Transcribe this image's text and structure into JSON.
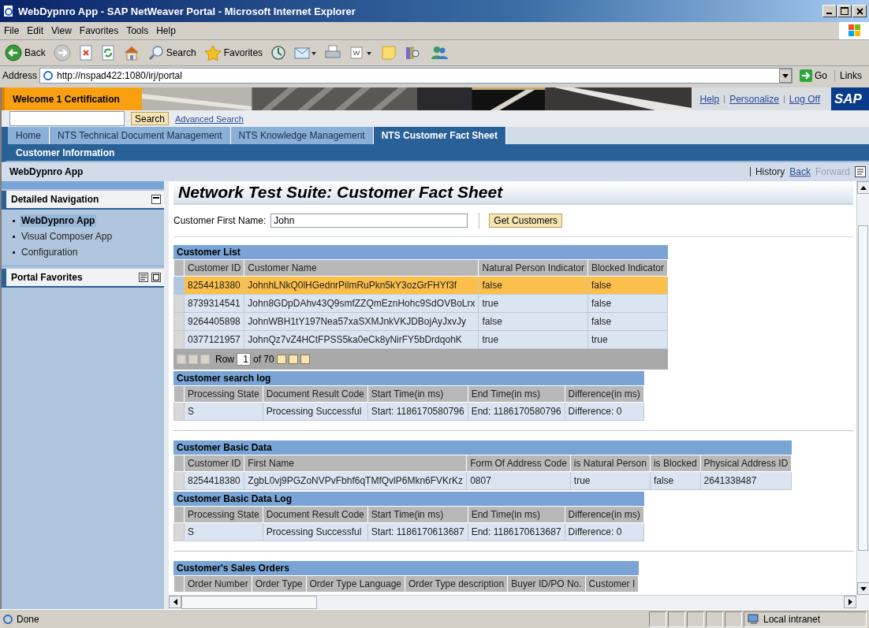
{
  "window": {
    "title": "WebDypnro App - SAP NetWeaver Portal - Microsoft Internet Explorer"
  },
  "menu": [
    "File",
    "Edit",
    "View",
    "Favorites",
    "Tools",
    "Help"
  ],
  "toolbar": [
    {
      "kind": "back",
      "label": "Back"
    },
    {
      "kind": "forward"
    },
    {
      "kind": "stop"
    },
    {
      "kind": "refresh"
    },
    {
      "kind": "home"
    },
    {
      "kind": "search",
      "label": "Search"
    },
    {
      "kind": "favorites",
      "label": "Favorites"
    },
    {
      "kind": "media"
    },
    {
      "kind": "mail"
    },
    {
      "kind": "print"
    },
    {
      "kind": "edit"
    },
    {
      "kind": "folder"
    },
    {
      "kind": "research"
    },
    {
      "kind": "messenger"
    }
  ],
  "address": {
    "label": "Address",
    "value": "http://nspad422:1080/irj/portal",
    "go": "Go",
    "links": "Links"
  },
  "portal": {
    "welcome": "Welcome 1 Certification",
    "links": [
      "Help",
      "Personalize",
      "Log Off"
    ],
    "logo": "SAP",
    "search_button": "Search",
    "advanced_search": "Advanced Search"
  },
  "tabs": [
    {
      "label": "Home",
      "selected": false
    },
    {
      "label": "NTS Technical Document Management",
      "selected": false
    },
    {
      "label": "NTS Knowledge Management",
      "selected": false
    },
    {
      "label": "NTS Customer Fact Sheet",
      "selected": true
    }
  ],
  "subnav": [
    "Customer Information"
  ],
  "page": {
    "title": "WebDypnro App",
    "history": "History",
    "back": {
      "label": "Back",
      "disabled": false
    },
    "forward": {
      "label": "Forward",
      "disabled": true
    }
  },
  "sidebar": {
    "panels": [
      {
        "title": "Detailed Navigation",
        "items": [
          {
            "label": "WebDypnro App",
            "selected": true
          },
          {
            "label": "Visual Composer App",
            "selected": false
          },
          {
            "label": "Configuration",
            "selected": false
          }
        ]
      },
      {
        "title": "Portal Favorites"
      }
    ]
  },
  "content": {
    "heading": "Network Test Suite: Customer Fact Sheet",
    "form": {
      "label": "Customer First Name:",
      "value": "John",
      "button": "Get Customers"
    },
    "sections": [
      {
        "title": "Customer List",
        "columns": [
          "Customer ID",
          "Customer Name",
          "Natural Person Indicator",
          "Blocked Indicator"
        ],
        "rows": [
          {
            "cells": [
              "8254418380",
              "JohnhLNkQ0lHGednrPilmRuPkn5kY3ozGrFHYf3f",
              "false",
              "false"
            ],
            "selected": true
          },
          {
            "cells": [
              "8739314541",
              "John8GDpDAhv43Q9smfZZQmEznHohc9SdOVBoLrx",
              "true",
              "false"
            ],
            "selected": false
          },
          {
            "cells": [
              "9264405898",
              "JohnWBH1tY197Nea57xaSXMJnkVKJDBojAyJxvJy",
              "false",
              "false"
            ],
            "selected": false
          },
          {
            "cells": [
              "0377121957",
              "JohnQz7vZ4HCtFPSS5ka0eCk8yNirFY5bDrdqohK",
              "true",
              "true"
            ],
            "selected": false
          }
        ],
        "pager": {
          "label": "Row",
          "value": "1",
          "of": "of 70"
        }
      },
      {
        "title": "Customer search log",
        "columns": [
          "Processing State",
          "Document Result Code",
          "Start Time(in ms)",
          "End Time(in ms)",
          "Difference(in ms)"
        ],
        "rows": [
          {
            "cells": [
              "S",
              "Processing Successful",
              "Start: 1186170580796",
              "End: 1186170580796",
              "Difference: 0"
            ],
            "selected": false
          }
        ],
        "rule_after": true
      },
      {
        "title": "Customer Basic Data",
        "columns": [
          "Customer ID",
          "First Name",
          "Form Of Address Code",
          "is Natural Person",
          "is Blocked",
          "Physical Address ID"
        ],
        "rows": [
          {
            "cells": [
              "8254418380",
              "ZgbL0vj9PGZoNVPvFbhf6qTMfQvlP6Mkn6FVKrKz",
              "0807",
              "true",
              "false",
              "2641338487"
            ],
            "selected": false
          }
        ]
      },
      {
        "title": "Customer Basic Data Log",
        "columns": [
          "Processing State",
          "Document Result Code",
          "Start Time(in ms)",
          "End Time(in ms)",
          "Difference(in ms)"
        ],
        "rows": [
          {
            "cells": [
              "S",
              "Processing Successful",
              "Start: 1186170613687",
              "End: 1186170613687",
              "Difference: 0"
            ],
            "selected": false
          }
        ],
        "rule_after": true
      },
      {
        "title": "Customer's Sales Orders",
        "columns": [
          "Order Number",
          "Order Type",
          "Order Type Language",
          "Order Type description",
          "Buyer ID/PO No.",
          "Customer I"
        ]
      }
    ]
  },
  "status": {
    "text": "Done",
    "zone": "Local intranet"
  }
}
